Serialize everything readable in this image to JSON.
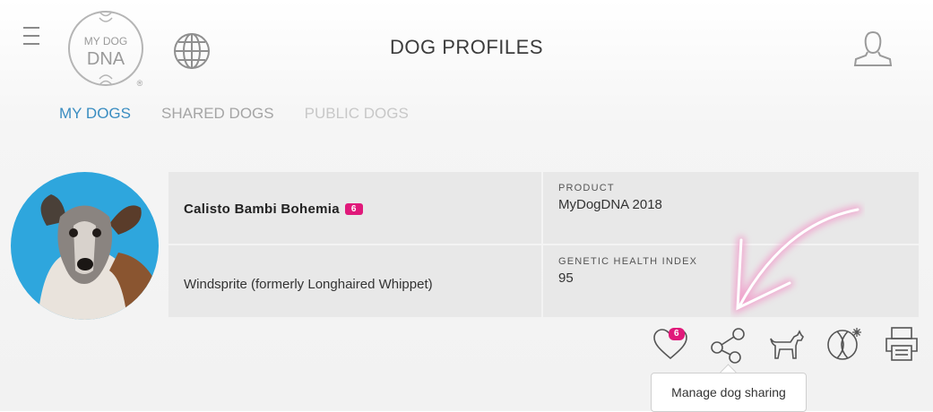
{
  "header": {
    "title": "DOG PROFILES",
    "logo_line1": "MY DOG",
    "logo_line2": "DNA",
    "logo_mark": "®"
  },
  "tabs": [
    {
      "label": "MY DOGS",
      "active": true
    },
    {
      "label": "SHARED DOGS",
      "active": false
    },
    {
      "label": "PUBLIC DOGS",
      "active": false
    }
  ],
  "dog": {
    "name": "Calisto Bambi Bohemia",
    "name_badge": "6",
    "breed": "Windsprite (formerly Longhaired Whippet)",
    "product_label": "PRODUCT",
    "product_value": "MyDogDNA 2018",
    "ghi_label": "GENETIC HEALTH INDEX",
    "ghi_value": "95"
  },
  "actions": {
    "heart_badge": "6",
    "icons": [
      "heart-icon",
      "share-icon",
      "dog-icon",
      "dna-icon",
      "printer-icon"
    ]
  },
  "tooltip": {
    "text": "Manage dog sharing"
  },
  "colors": {
    "accent": "#3a8dc1",
    "badge": "#e0197a",
    "cell": "#e8e8e8"
  }
}
